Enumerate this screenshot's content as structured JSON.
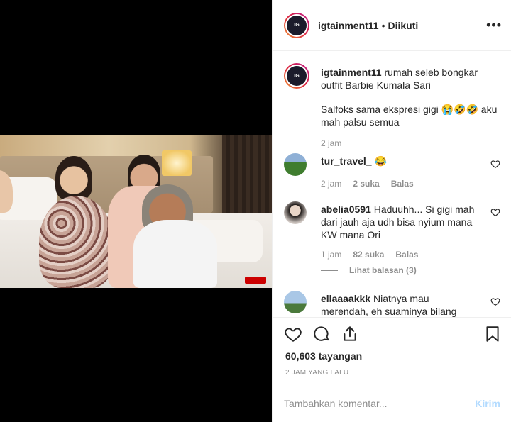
{
  "header": {
    "username": "igtainment11",
    "separator": "•",
    "follow_state": "Diikuti",
    "more": "•••"
  },
  "caption": {
    "username": "igtainment11",
    "text": "rumah seleb bongkar outfit Barbie Kumala Sari",
    "text2": "Salfoks sama ekspresi gigi 😭🤣🤣 aku mah palsu semua",
    "time": "2 jam"
  },
  "comments": [
    {
      "username": "tur_travel_",
      "text": "😂",
      "time": "2 jam",
      "likes": "2 suka",
      "reply": "Balas"
    },
    {
      "username": "abelia0591",
      "text": "Haduuhh... Si gigi mah dari jauh aja udh bisa nyium mana KW mana Ori",
      "time": "1 jam",
      "likes": "82 suka",
      "reply": "Balas",
      "view_replies": "Lihat balasan (3)"
    },
    {
      "username": "ellaaaakkk",
      "text": "Niatnya mau merendah, eh suaminya bilang"
    }
  ],
  "actions": {
    "views": "60,603 tayangan",
    "posted": "2 JAM YANG LALU"
  },
  "add_comment": {
    "placeholder": "Tambahkan komentar...",
    "send": "Kirim"
  },
  "colors": {
    "link_disabled": "#b3dbff",
    "muted": "#8e8e8e",
    "text": "#262626",
    "border": "#efefef"
  }
}
